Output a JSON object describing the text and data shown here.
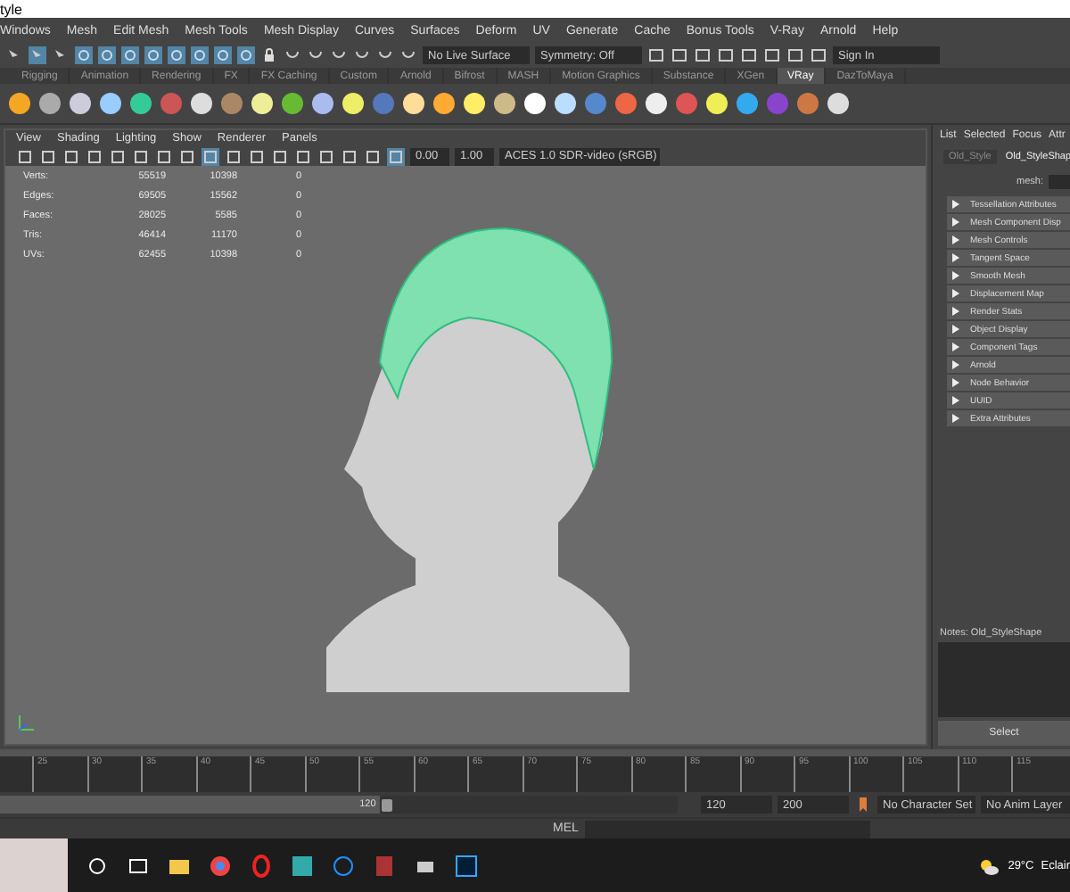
{
  "window": {
    "title": "tyle"
  },
  "menu": [
    "Windows",
    "Mesh",
    "Edit Mesh",
    "Mesh Tools",
    "Mesh Display",
    "Curves",
    "Surfaces",
    "Deform",
    "UV",
    "Generate",
    "Cache",
    "Bonus Tools",
    "V-Ray",
    "Arnold",
    "Help"
  ],
  "status_line": {
    "live_surface": "No Live Surface",
    "symmetry": "Symmetry: Off",
    "sign_in": "Sign In"
  },
  "shelf_tabs": [
    {
      "label": "Rigging",
      "selected": false
    },
    {
      "label": "Animation",
      "selected": false
    },
    {
      "label": "Rendering",
      "selected": false
    },
    {
      "label": "FX",
      "selected": false
    },
    {
      "label": "FX Caching",
      "selected": false
    },
    {
      "label": "Custom",
      "selected": false
    },
    {
      "label": "Arnold",
      "selected": false
    },
    {
      "label": "Bifrost",
      "selected": false
    },
    {
      "label": "MASH",
      "selected": false
    },
    {
      "label": "Motion Graphics",
      "selected": false
    },
    {
      "label": "Substance",
      "selected": false
    },
    {
      "label": "XGen",
      "selected": false
    },
    {
      "label": "VRay",
      "selected": true
    },
    {
      "label": "DazToMaya",
      "selected": false
    }
  ],
  "viewport": {
    "menu": [
      "View",
      "Shading",
      "Lighting",
      "Show",
      "Renderer",
      "Panels"
    ],
    "exposure": "0.00",
    "gamma": "1.00",
    "color_space": "ACES 1.0 SDR-video (sRGB)",
    "stats": [
      {
        "label": "Verts:",
        "col_1": "55519",
        "col_2": "10398",
        "col_3": "0"
      },
      {
        "label": "Edges:",
        "col_1": "69505",
        "col_2": "15562",
        "col_3": "0"
      },
      {
        "label": "Faces:",
        "col_1": "28025",
        "col_2": "5585",
        "col_3": "0"
      },
      {
        "label": "Tris:",
        "col_1": "46414",
        "col_2": "11170",
        "col_3": "0"
      },
      {
        "label": "UVs:",
        "col_1": "62455",
        "col_2": "10398",
        "col_3": "0"
      }
    ]
  },
  "attribute_editor": {
    "menu": [
      "List",
      "Selected",
      "Focus",
      "Attr"
    ],
    "tabs": [
      {
        "label": "Old_Style",
        "selected": false
      },
      {
        "label": "Old_StyleShap",
        "selected": true
      }
    ],
    "mesh_label": "mesh:",
    "sections": [
      "Tessellation Attributes",
      "Mesh Component Disp",
      "Mesh Controls",
      "Tangent Space",
      "Smooth Mesh",
      "Displacement Map",
      "Render Stats",
      "Object Display",
      "Component Tags",
      "Arnold",
      "Node Behavior",
      "UUID",
      "Extra Attributes"
    ],
    "notes": "Notes:  Old_StyleShape",
    "button": "Select"
  },
  "timeline": {
    "ticks": [
      "25",
      "30",
      "35",
      "40",
      "45",
      "50",
      "55",
      "60",
      "65",
      "70",
      "75",
      "80",
      "85",
      "90",
      "95",
      "100",
      "105",
      "110",
      "115"
    ]
  },
  "range": {
    "slider_value": "120",
    "level": 0.56,
    "end": "120",
    "max": "200",
    "character_set": "No Character Set",
    "anim_layer": "No Anim Layer"
  },
  "command_line": {
    "label": "MEL"
  },
  "taskbar": {
    "temperature": "29°C",
    "weather": "Eclair"
  }
}
